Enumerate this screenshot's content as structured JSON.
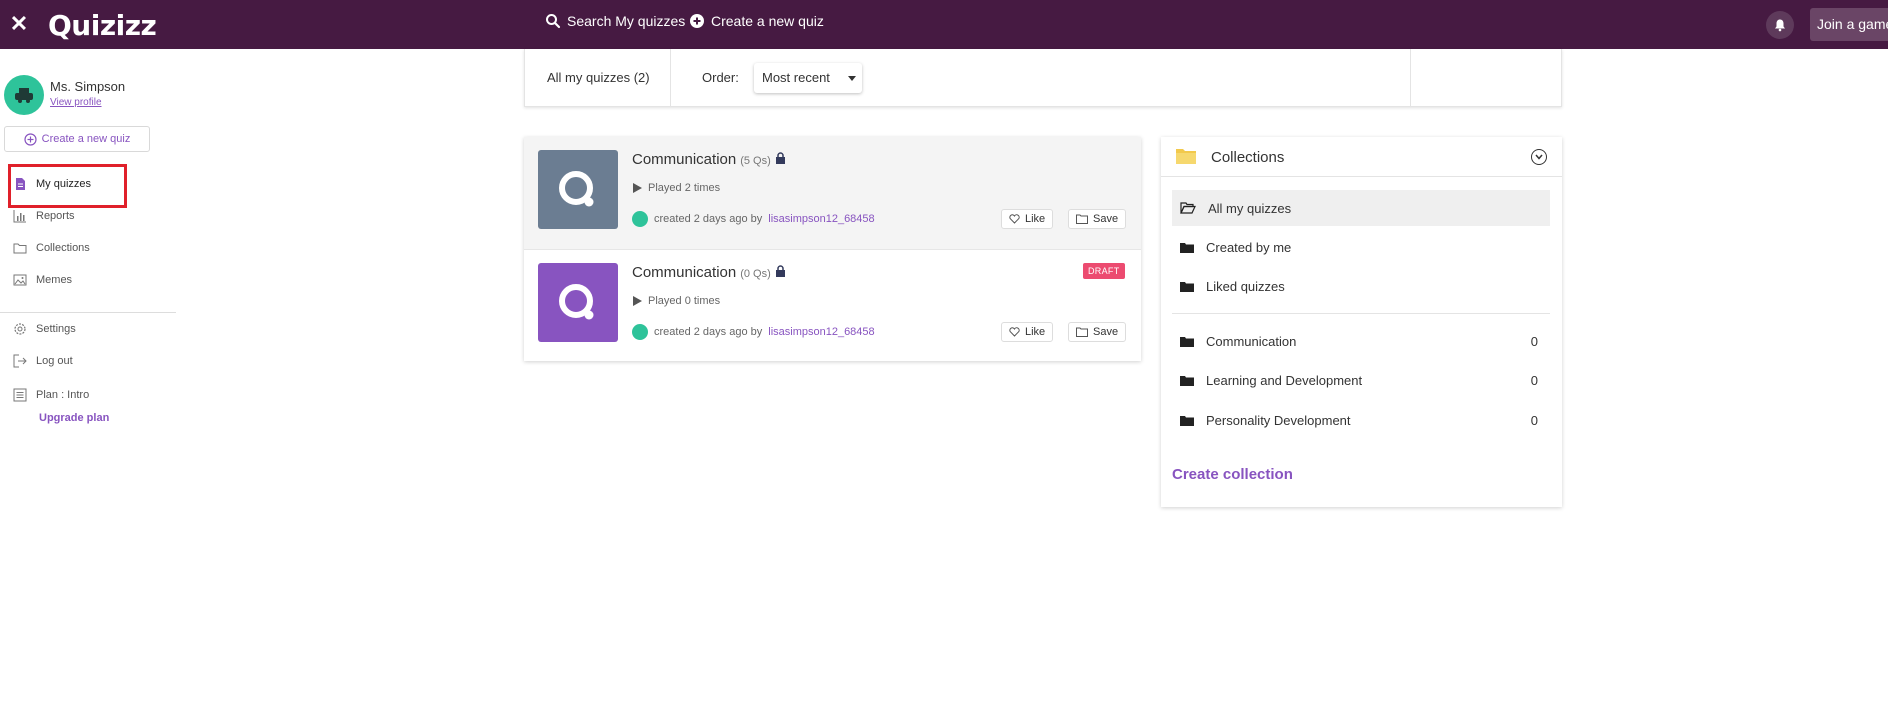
{
  "topbar": {
    "close_icon": "close-icon",
    "logo": "Quizizz",
    "search_label": "Search My quizzes",
    "create_label": "Create a new quiz",
    "join_label": "Join a game"
  },
  "sidebar": {
    "user_name": "Ms. Simpson",
    "view_profile": "View profile",
    "create_quiz": "Create a new quiz",
    "items": [
      {
        "label": "My quizzes",
        "icon": "document-icon"
      },
      {
        "label": "Reports",
        "icon": "bar-chart-icon"
      },
      {
        "label": "Collections",
        "icon": "folder-icon"
      },
      {
        "label": "Memes",
        "icon": "image-icon"
      },
      {
        "label": "Settings",
        "icon": "gear-icon"
      },
      {
        "label": "Log out",
        "icon": "logout-icon"
      },
      {
        "label": "Plan : Intro",
        "icon": "plan-icon"
      }
    ],
    "upgrade": "Upgrade plan"
  },
  "filter": {
    "all_label": "All my quizzes (2)",
    "order_label": "Order:",
    "order_value": "Most recent"
  },
  "quizzes": [
    {
      "title": "Communication",
      "qs": "(5 Qs)",
      "played": "Played 2 times",
      "created": "created 2 days ago by",
      "author": "lisasimpson12_68458",
      "like": "Like",
      "save": "Save",
      "thumb_color": "#6b7d92"
    },
    {
      "title": "Communication",
      "qs": "(0 Qs)",
      "played": "Played 0 times",
      "created": "created 2 days ago by",
      "author": "lisasimpson12_68458",
      "like": "Like",
      "save": "Save",
      "badge": "DRAFT",
      "thumb_color": "#8854c0"
    }
  ],
  "collections": {
    "title": "Collections",
    "items": [
      {
        "label": "All my quizzes"
      },
      {
        "label": "Created by me"
      },
      {
        "label": "Liked quizzes"
      }
    ],
    "folders": [
      {
        "label": "Communication",
        "count": "0"
      },
      {
        "label": "Learning and Development",
        "count": "0"
      },
      {
        "label": "Personality Development",
        "count": "0"
      }
    ],
    "create_label": "Create collection"
  },
  "colors": {
    "header": "#461a42",
    "accent": "#8854c0",
    "draft": "#ec4b70",
    "highlight": "#e0202a"
  }
}
